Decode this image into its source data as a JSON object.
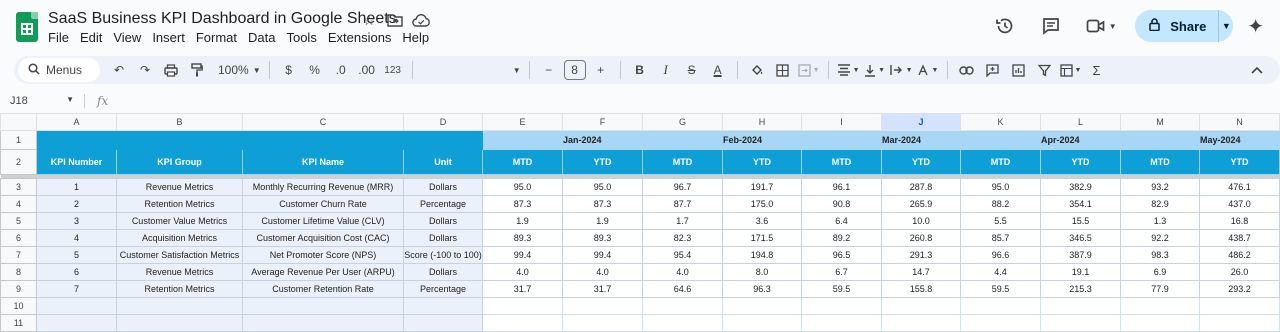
{
  "doc": {
    "title": "SaaS Business KPI Dashboard in Google Sheets",
    "menu": [
      "File",
      "Edit",
      "View",
      "Insert",
      "Format",
      "Data",
      "Tools",
      "Extensions",
      "Help"
    ],
    "share_label": "Share"
  },
  "toolbar": {
    "menus_label": "Menus",
    "zoom": "100%",
    "currency": "$",
    "percent": "%",
    "dec_decrease": ".0",
    "dec_increase": ".00",
    "number_format": "123",
    "font_size": "8",
    "minus": "−",
    "plus": "+",
    "bold": "B",
    "italic": "I",
    "strike": "S",
    "text_color": "A",
    "sigma": "Σ"
  },
  "formula_bar": {
    "cell_ref": "J18",
    "fx": "fx",
    "value": ""
  },
  "columns": [
    "A",
    "B",
    "C",
    "D",
    "E",
    "F",
    "G",
    "H",
    "I",
    "J",
    "K",
    "L",
    "M",
    "N"
  ],
  "selected_column": "J",
  "row_numbers": [
    "1",
    "2",
    "3",
    "4",
    "5",
    "6",
    "7",
    "8",
    "9",
    "10",
    "11"
  ],
  "headers": {
    "kpi_number": "KPI Number",
    "kpi_group": "KPI Group",
    "kpi_name": "KPI Name",
    "unit": "Unit",
    "months": [
      "Jan-2024",
      "Feb-2024",
      "Mar-2024",
      "Apr-2024",
      "May-2024"
    ],
    "mtd": "MTD",
    "ytd": "YTD"
  },
  "rows": [
    {
      "num": "1",
      "group": "Revenue Metrics",
      "name": "Monthly Recurring Revenue (MRR)",
      "unit": "Dollars",
      "values": [
        "95.0",
        "95.0",
        "96.7",
        "191.7",
        "96.1",
        "287.8",
        "95.0",
        "382.9",
        "93.2",
        "476.1"
      ]
    },
    {
      "num": "2",
      "group": "Retention Metrics",
      "name": "Customer Churn Rate",
      "unit": "Percentage",
      "values": [
        "87.3",
        "87.3",
        "87.7",
        "175.0",
        "90.8",
        "265.9",
        "88.2",
        "354.1",
        "82.9",
        "437.0"
      ]
    },
    {
      "num": "3",
      "group": "Customer Value Metrics",
      "name": "Customer Lifetime Value (CLV)",
      "unit": "Dollars",
      "values": [
        "1.9",
        "1.9",
        "1.7",
        "3.6",
        "6.4",
        "10.0",
        "5.5",
        "15.5",
        "1.3",
        "16.8"
      ]
    },
    {
      "num": "4",
      "group": "Acquisition Metrics",
      "name": "Customer Acquisition Cost (CAC)",
      "unit": "Dollars",
      "values": [
        "89.3",
        "89.3",
        "82.3",
        "171.5",
        "89.2",
        "260.8",
        "85.7",
        "346.5",
        "92.2",
        "438.7"
      ]
    },
    {
      "num": "5",
      "group": "Customer Satisfaction Metrics",
      "name": "Net Promoter Score (NPS)",
      "unit": "Score (-100 to 100)",
      "values": [
        "99.4",
        "99.4",
        "95.4",
        "194.8",
        "96.5",
        "291.3",
        "96.6",
        "387.9",
        "98.3",
        "486.2"
      ]
    },
    {
      "num": "6",
      "group": "Revenue Metrics",
      "name": "Average Revenue Per User (ARPU)",
      "unit": "Dollars",
      "values": [
        "4.0",
        "4.0",
        "4.0",
        "8.0",
        "6.7",
        "14.7",
        "4.4",
        "19.1",
        "6.9",
        "26.0"
      ]
    },
    {
      "num": "7",
      "group": "Retention Metrics",
      "name": "Customer Retention Rate",
      "unit": "Percentage",
      "values": [
        "31.7",
        "31.7",
        "64.6",
        "96.3",
        "59.5",
        "155.8",
        "59.5",
        "215.3",
        "77.9",
        "293.2"
      ]
    }
  ],
  "colors": {
    "header_blue": "#0e9fd6",
    "month_blue": "#a8d6f5",
    "kpi_cell_bg": "#eaf1fa",
    "share_bg": "#c2e7ff"
  }
}
